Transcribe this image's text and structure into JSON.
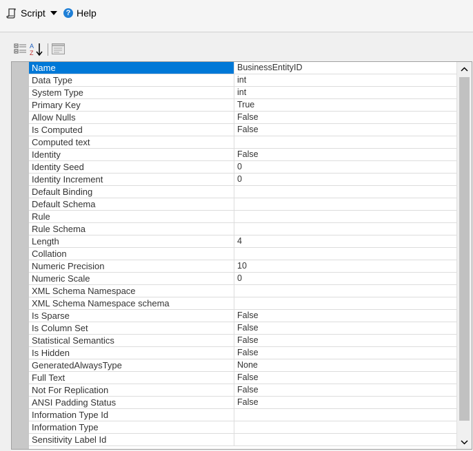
{
  "toolbar": {
    "script_label": "Script",
    "help_label": "Help"
  },
  "properties": [
    {
      "name": "Name",
      "value": "BusinessEntityID",
      "selected": true
    },
    {
      "name": "Data Type",
      "value": "int"
    },
    {
      "name": "System Type",
      "value": "int"
    },
    {
      "name": "Primary Key",
      "value": "True"
    },
    {
      "name": "Allow Nulls",
      "value": "False"
    },
    {
      "name": "Is Computed",
      "value": "False"
    },
    {
      "name": "Computed text",
      "value": ""
    },
    {
      "name": "Identity",
      "value": "False"
    },
    {
      "name": "Identity Seed",
      "value": "0"
    },
    {
      "name": "Identity Increment",
      "value": "0"
    },
    {
      "name": "Default Binding",
      "value": ""
    },
    {
      "name": "Default Schema",
      "value": ""
    },
    {
      "name": "Rule",
      "value": ""
    },
    {
      "name": "Rule Schema",
      "value": ""
    },
    {
      "name": "Length",
      "value": "4"
    },
    {
      "name": "Collation",
      "value": ""
    },
    {
      "name": "Numeric Precision",
      "value": "10"
    },
    {
      "name": "Numeric Scale",
      "value": "0"
    },
    {
      "name": "XML Schema Namespace",
      "value": ""
    },
    {
      "name": "XML Schema Namespace schema",
      "value": ""
    },
    {
      "name": "Is Sparse",
      "value": "False"
    },
    {
      "name": "Is Column Set",
      "value": "False"
    },
    {
      "name": "Statistical Semantics",
      "value": "False"
    },
    {
      "name": "Is Hidden",
      "value": "False"
    },
    {
      "name": "GeneratedAlwaysType",
      "value": "None"
    },
    {
      "name": "Full Text",
      "value": "False"
    },
    {
      "name": "Not For Replication",
      "value": "False"
    },
    {
      "name": "ANSI Padding Status",
      "value": "False"
    },
    {
      "name": "Information Type Id",
      "value": ""
    },
    {
      "name": "Information Type",
      "value": ""
    },
    {
      "name": "Sensitivity Label Id",
      "value": ""
    }
  ]
}
